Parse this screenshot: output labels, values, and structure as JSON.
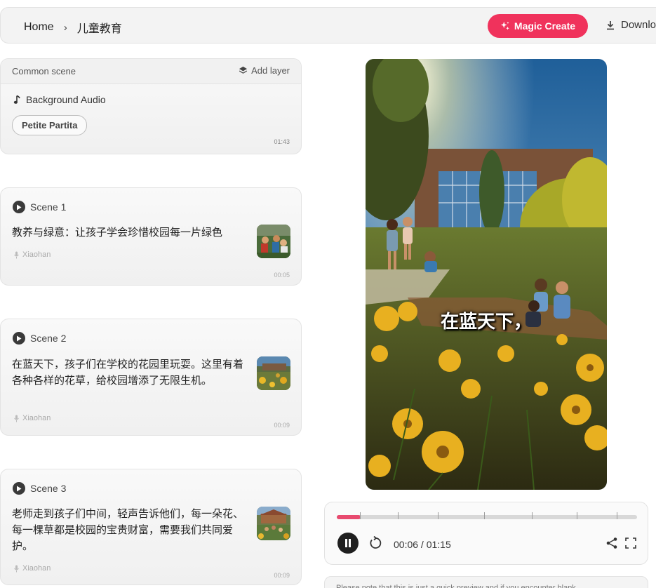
{
  "header": {
    "breadcrumb_home": "Home",
    "breadcrumb_current": "儿童教育",
    "magic_create": "Magic Create",
    "download": "Download"
  },
  "common_scene": {
    "title": "Common scene",
    "add_layer": "Add layer",
    "background_audio": "Background Audio",
    "track": "Petite Partita",
    "duration": "01:43"
  },
  "scenes": [
    {
      "label": "Scene 1",
      "text": "教养与绿意：让孩子学会珍惜校园每一片绿色",
      "voice": "Xiaohan",
      "duration": "00:05"
    },
    {
      "label": "Scene 2",
      "text": "在蓝天下，孩子们在学校的花园里玩耍。这里有着各种各样的花草，给校园增添了无限生机。",
      "voice": "Xiaohan",
      "duration": "00:09"
    },
    {
      "label": "Scene 3",
      "text": "老师走到孩子们中间，轻声告诉他们，每一朵花、每一棵草都是校园的宝贵财富，需要我们共同爱护。",
      "voice": "Xiaohan",
      "duration": "00:09"
    }
  ],
  "preview": {
    "caption": "在蓝天下，"
  },
  "player": {
    "current": "00:06",
    "total": "01:15",
    "timecode": "00:06 / 01:15",
    "progress": 0.08
  },
  "notice": "Please note that this is just a quick preview and if you encounter blank",
  "colors": {
    "accent": "#f0325c",
    "progress": "#e84a6f"
  }
}
